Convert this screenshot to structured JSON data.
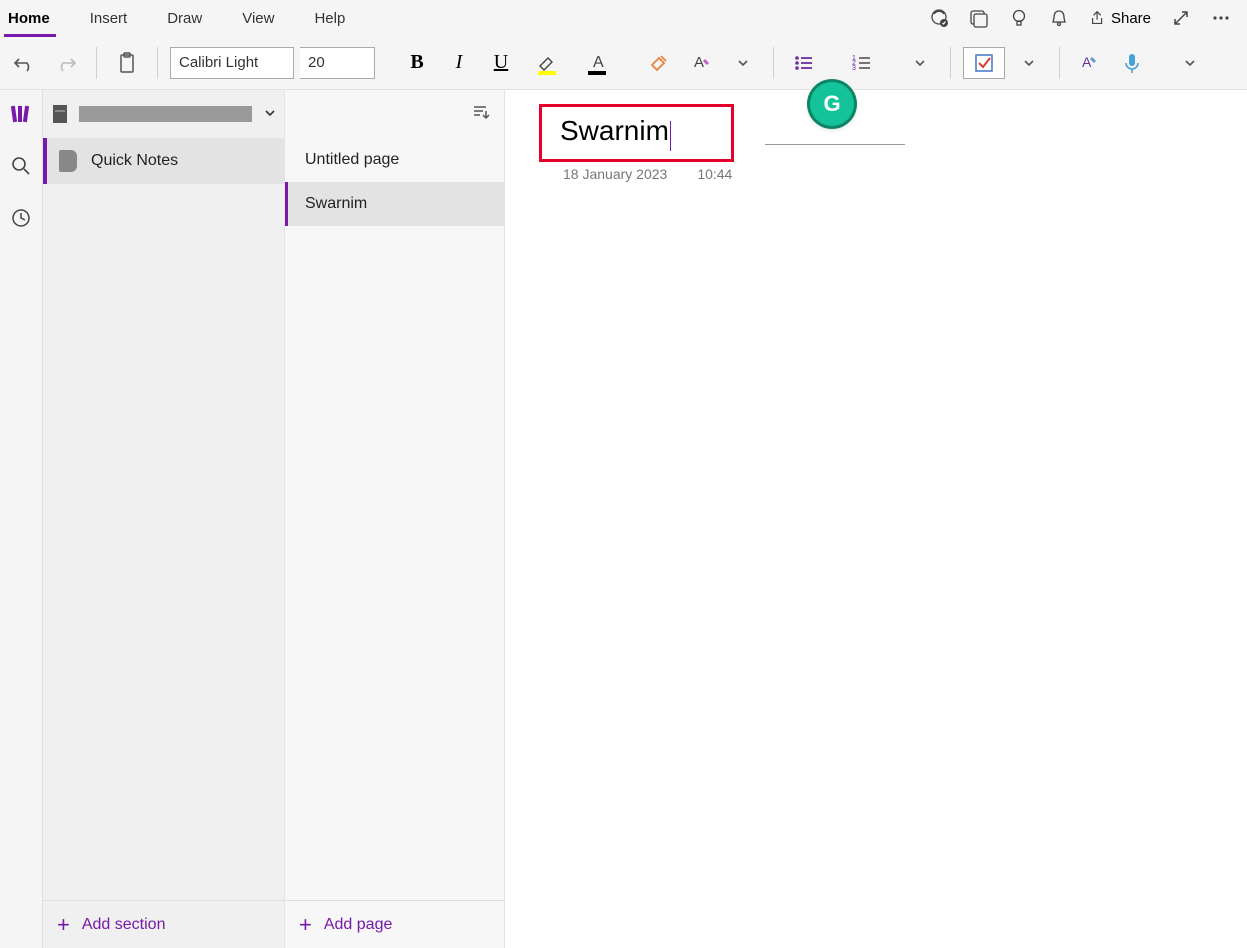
{
  "menu": {
    "tabs": [
      "Home",
      "Insert",
      "Draw",
      "View",
      "Help"
    ],
    "active_index": 0,
    "share_label": "Share"
  },
  "toolbar": {
    "font_name": "Calibri Light",
    "font_size": "20"
  },
  "sidebar": {
    "section_label": "Quick Notes",
    "add_section_label": "Add section"
  },
  "pages": {
    "items": [
      {
        "title": "Untitled page",
        "selected": false
      },
      {
        "title": "Swarnim",
        "selected": true
      }
    ],
    "add_page_label": "Add page"
  },
  "note": {
    "title": "Swarnim",
    "date": "18 January 2023",
    "time": "10:44"
  },
  "grammarly": {
    "glyph": "G"
  }
}
